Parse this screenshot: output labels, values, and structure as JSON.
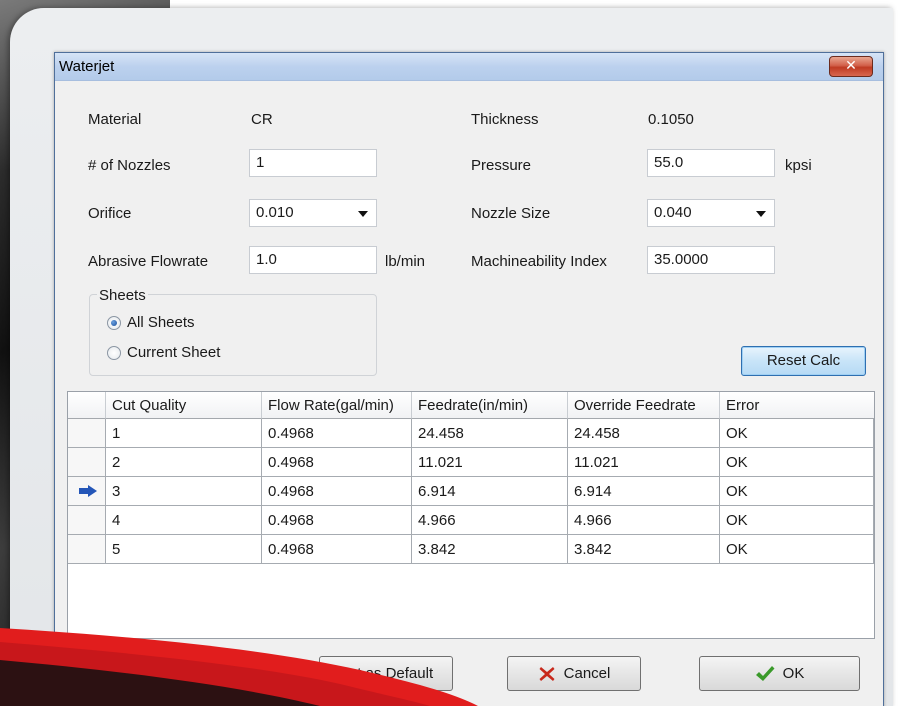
{
  "window": {
    "title": "Waterjet",
    "close_glyph": "✕"
  },
  "form": {
    "material_label": "Material",
    "material_value": "CR",
    "thickness_label": "Thickness",
    "thickness_value": "0.1050",
    "nozzles_label": "# of Nozzles",
    "nozzles_value": "1",
    "pressure_label": "Pressure",
    "pressure_value": "55.0",
    "pressure_unit": "kpsi",
    "orifice_label": "Orifice",
    "orifice_value": "0.010",
    "nozzle_size_label": "Nozzle Size",
    "nozzle_size_value": "0.040",
    "abrasive_label": "Abrasive Flowrate",
    "abrasive_value": "1.0",
    "abrasive_unit": "lb/min",
    "machineability_label": "Machineability Index",
    "machineability_value": "35.0000"
  },
  "sheets": {
    "title": "Sheets",
    "options": [
      {
        "label": "All Sheets",
        "selected": true
      },
      {
        "label": "Current Sheet",
        "selected": false
      }
    ]
  },
  "reset_label": "Reset Calc",
  "grid": {
    "columns": [
      "Cut Quality",
      "Flow Rate(gal/min)",
      "Feedrate(in/min)",
      "Override Feedrate",
      "Error"
    ],
    "rows": [
      [
        "1",
        "0.4968",
        "24.458",
        "24.458",
        "OK"
      ],
      [
        "2",
        "0.4968",
        "11.021",
        "11.021",
        "OK"
      ],
      [
        "3",
        "0.4968",
        "6.914",
        "6.914",
        "OK"
      ],
      [
        "4",
        "0.4968",
        "4.966",
        "4.966",
        "OK"
      ],
      [
        "5",
        "0.4968",
        "3.842",
        "3.842",
        "OK"
      ]
    ],
    "current_row_icon": "arrow-right-icon"
  },
  "buttons": {
    "default_label": "Set as Default",
    "cancel_label": "Cancel",
    "ok_label": "OK"
  },
  "colors": {
    "accent_red": "#e11d1d",
    "title_bar": "#bcd1ee",
    "close_button": "#c9462e",
    "reset_button": "#c8e4f8"
  }
}
